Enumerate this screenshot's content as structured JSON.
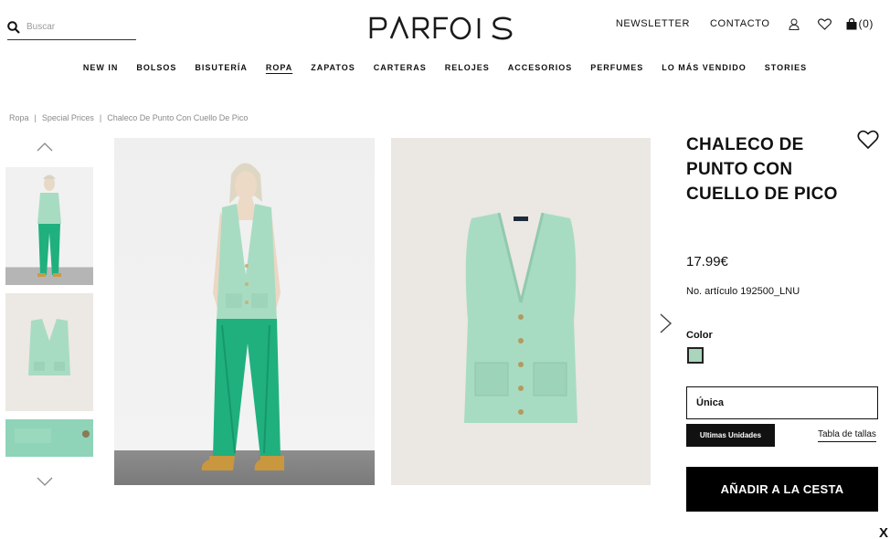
{
  "header": {
    "search_placeholder": "Buscar",
    "brand": "PARFOIS",
    "links": [
      "NEWSLETTER",
      "CONTACTO"
    ],
    "cart_count": "(0)"
  },
  "nav": {
    "items": [
      "NEW IN",
      "BOLSOS",
      "BISUTERÍA",
      "ROPA",
      "ZAPATOS",
      "CARTERAS",
      "RELOJES",
      "ACCESORIOS",
      "PERFUMES",
      "LO MÁS VENDIDO",
      "STORIES"
    ],
    "active": "ROPA"
  },
  "breadcrumb": [
    "Ropa",
    "Special Prices",
    "Chaleco De Punto Con Cuello De Pico"
  ],
  "breadcrumb_separator": "|",
  "product": {
    "title": "CHALECO DE PUNTO CON CUELLO DE PICO",
    "price": "17.99€",
    "sku": "No. artículo 192500_LNU",
    "color_label": "Color",
    "color_swatch": "#a9d5bd",
    "size": "Única",
    "stock_badge": "Ultimas Unidades",
    "size_table_link": "Tabla de tallas",
    "add_to_cart": "AÑADIR A LA CESTA"
  },
  "close_label": "X",
  "colors": {
    "vest": "#a8dcc2",
    "pants": "#1fb07e",
    "primary": "#000000"
  }
}
